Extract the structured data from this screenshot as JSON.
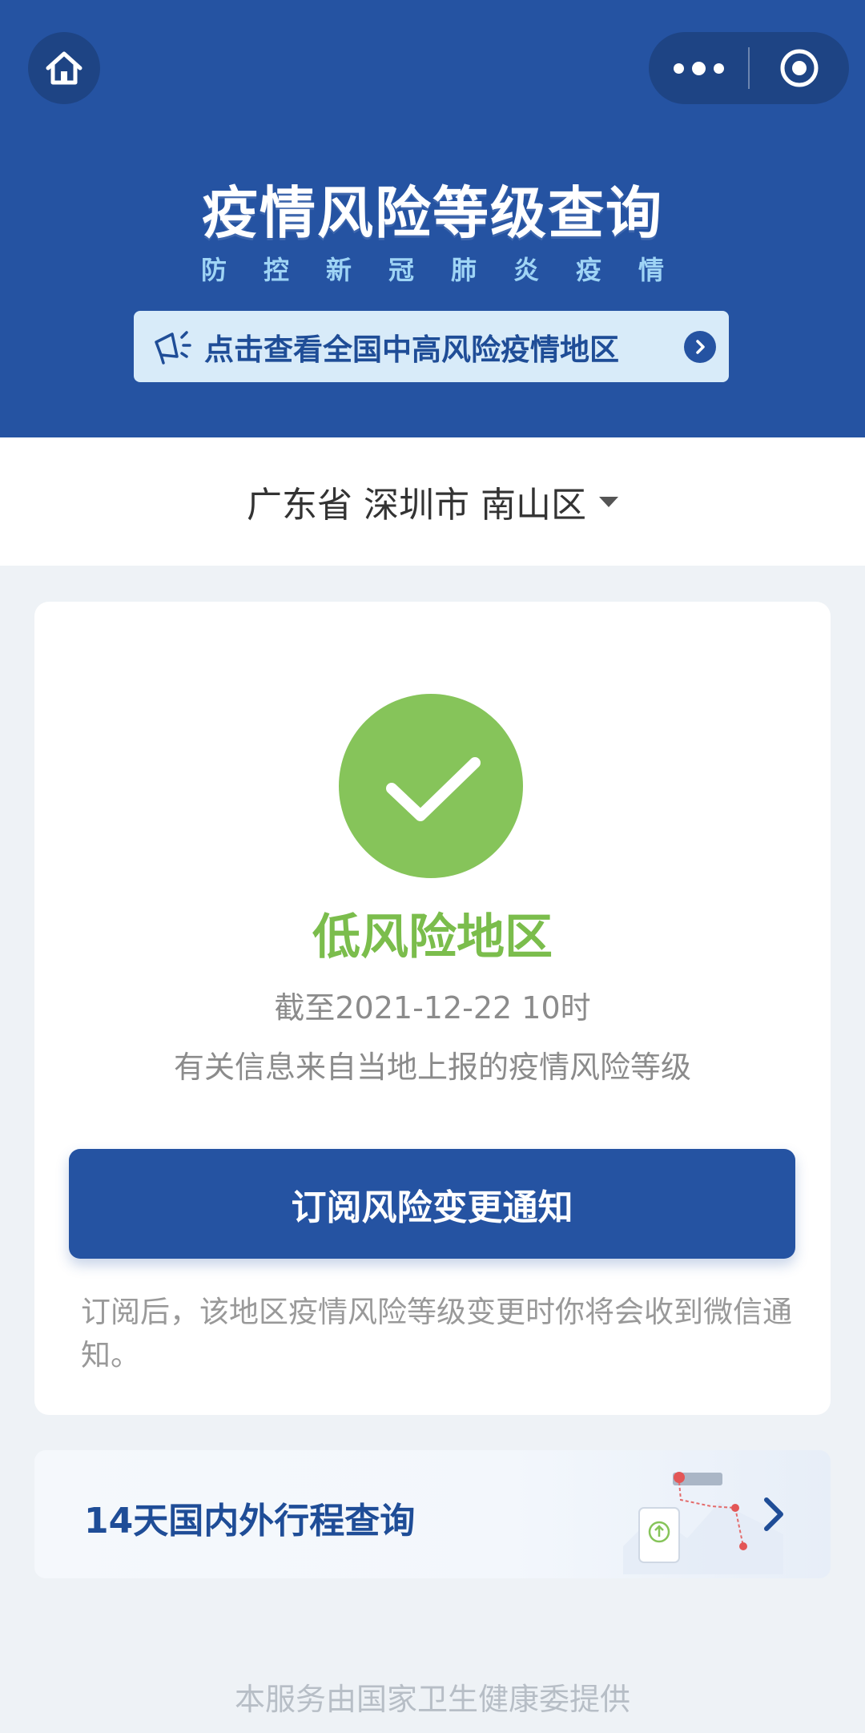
{
  "header": {
    "title": "疫情风险等级查询",
    "subtitle": "防控新冠肺炎疫情",
    "notice": "点击查看全国中高风险疫情地区",
    "accent_color": "#2553a2"
  },
  "icons": {
    "home": "home-icon",
    "more": "more-dots-icon",
    "close": "target-icon",
    "megaphone": "megaphone-icon",
    "chevron": "chevron-right-icon",
    "check": "check-icon"
  },
  "location": {
    "text": "广东省 深圳市 南山区"
  },
  "risk": {
    "level": "低风险地区",
    "as_of": "截至2021-12-22 10时",
    "source": "有关信息来自当地上报的疫情风险等级",
    "color": "#86c45a"
  },
  "subscribe": {
    "button_label": "订阅风险变更通知",
    "note": "订阅后，该地区疫情风险等级变更时你将会收到微信通知。"
  },
  "trip": {
    "label": "14天国内外行程查询"
  },
  "footer": {
    "text": "本服务由国家卫生健康委提供"
  }
}
